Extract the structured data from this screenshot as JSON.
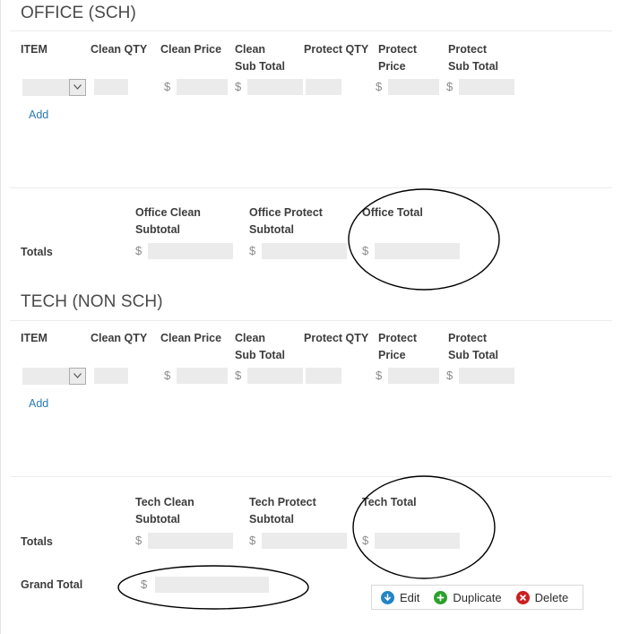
{
  "sections": [
    {
      "title": "OFFICE (SCH)",
      "headers": {
        "item": "ITEM",
        "clean_qty": "Clean QTY",
        "clean_price": "Clean Price",
        "clean_subtotal": "Clean\nSub Total",
        "protect_qty": "Protect QTY",
        "protect_price": "Protect\nPrice",
        "protect_subtotal": "Protect\nSub Total"
      },
      "row": {
        "item_value": "",
        "clean_qty_value": "",
        "clean_price_value": "",
        "clean_price_currency": "$",
        "clean_subtotal_value": "",
        "clean_subtotal_currency": "$",
        "protect_qty_value": "",
        "protect_price_value": "",
        "protect_price_currency": "$",
        "protect_subtotal_value": "",
        "protect_subtotal_currency": "$"
      },
      "add_label": "Add",
      "totals": {
        "row_label": "Totals",
        "clean_subtotal_header": "Office Clean\nSubtotal",
        "protect_subtotal_header": "Office Protect\nSubtotal",
        "total_header": "Office Total",
        "clean_subtotal_currency": "$",
        "clean_subtotal_value": "",
        "protect_subtotal_currency": "$",
        "protect_subtotal_value": "",
        "total_currency": "$",
        "total_value": ""
      }
    },
    {
      "title": "TECH (NON SCH)",
      "headers": {
        "item": "ITEM",
        "clean_qty": "Clean QTY",
        "clean_price": "Clean Price",
        "clean_subtotal": "Clean\nSub Total",
        "protect_qty": "Protect QTY",
        "protect_price": "Protect\nPrice",
        "protect_subtotal": "Protect\nSub Total"
      },
      "row": {
        "item_value": "",
        "clean_qty_value": "",
        "clean_price_value": "",
        "clean_price_currency": "$",
        "clean_subtotal_value": "",
        "clean_subtotal_currency": "$",
        "protect_qty_value": "",
        "protect_price_value": "",
        "protect_price_currency": "$",
        "protect_subtotal_value": "",
        "protect_subtotal_currency": "$"
      },
      "add_label": "Add",
      "totals": {
        "row_label": "Totals",
        "clean_subtotal_header": "Tech Clean\nSubtotal",
        "protect_subtotal_header": "Tech Protect\nSubtotal",
        "total_header": "Tech Total",
        "clean_subtotal_currency": "$",
        "clean_subtotal_value": "",
        "protect_subtotal_currency": "$",
        "protect_subtotal_value": "",
        "total_currency": "$",
        "total_value": ""
      }
    }
  ],
  "grand_total": {
    "label": "Grand Total",
    "currency": "$",
    "value": ""
  },
  "actions": [
    {
      "label": "Edit",
      "icon": "circle-arrow-down-icon",
      "color": "#2484c6"
    },
    {
      "label": "Duplicate",
      "icon": "circle-plus-icon",
      "color": "#2aa12a"
    },
    {
      "label": "Delete",
      "icon": "circle-x-icon",
      "color": "#cc1f1f"
    }
  ],
  "annotations": {
    "office_total_ellipse": "handdrawn-ellipse",
    "tech_total_ellipse": "handdrawn-ellipse",
    "grand_total_ellipse": "handdrawn-ellipse"
  },
  "colors": {
    "link": "#2a7ab0",
    "field_bg": "#ebebeb",
    "divider": "#ececec",
    "heading": "#4a4a4a"
  }
}
